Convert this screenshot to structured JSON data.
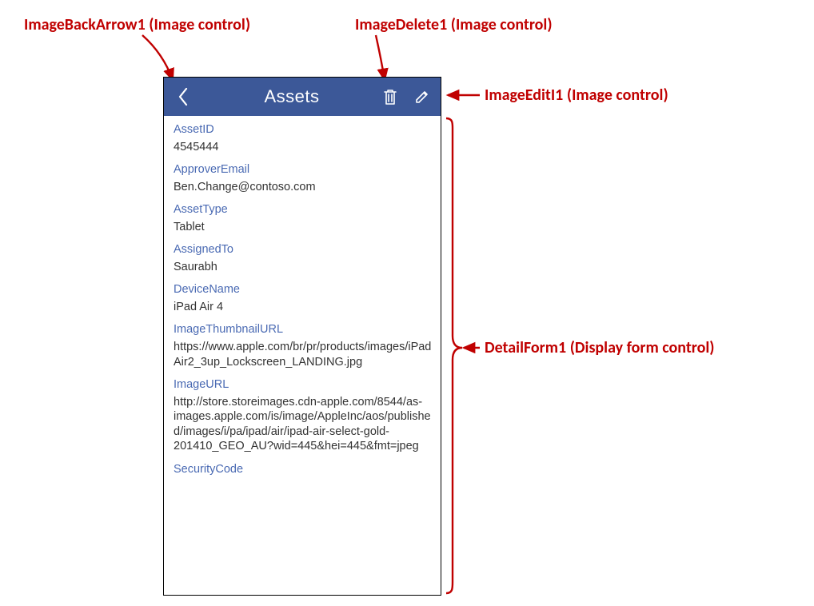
{
  "header": {
    "title": "Assets"
  },
  "fields": [
    {
      "label": "AssetID",
      "value": "4545444"
    },
    {
      "label": "ApproverEmail",
      "value": "Ben.Change@contoso.com"
    },
    {
      "label": "AssetType",
      "value": "Tablet"
    },
    {
      "label": "AssignedTo",
      "value": "Saurabh"
    },
    {
      "label": "DeviceName",
      "value": "iPad Air 4"
    },
    {
      "label": "ImageThumbnailURL",
      "value": "https://www.apple.com/br/pr/products/images/iPadAir2_3up_Lockscreen_LANDING.jpg"
    },
    {
      "label": "ImageURL",
      "value": "http://store.storeimages.cdn-apple.com/8544/as-images.apple.com/is/image/AppleInc/aos/published/images/i/pa/ipad/air/ipad-air-select-gold-201410_GEO_AU?wid=445&hei=445&fmt=jpeg"
    },
    {
      "label": "SecurityCode",
      "value": ""
    }
  ],
  "annotations": {
    "backArrow": "ImageBackArrow1 (Image control)",
    "delete": "ImageDelete1 (Image control)",
    "edit": "ImageEditI1 (Image control)",
    "detailForm": "DetailForm1 (Display form control)"
  }
}
